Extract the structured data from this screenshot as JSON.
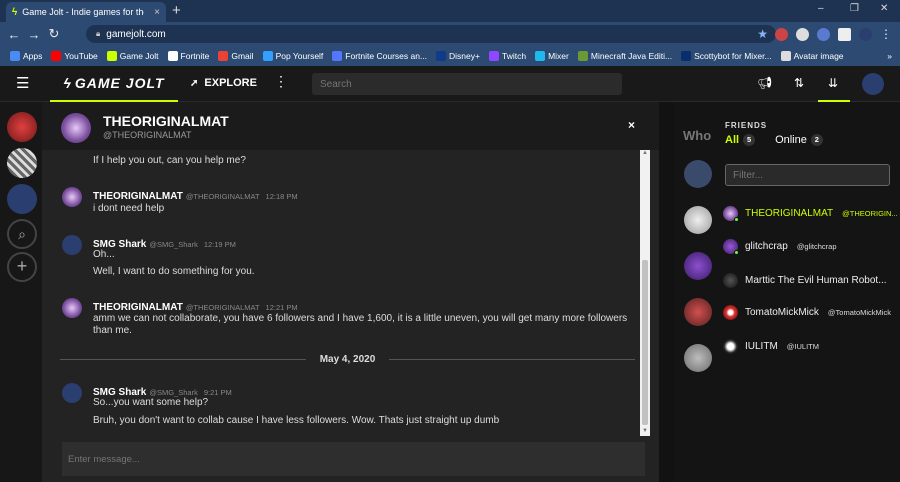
{
  "browser": {
    "tab_title": "Game Jolt - Indie games for the l",
    "tab_close": "×",
    "new_tab": "+",
    "window_controls": [
      "–",
      "❐",
      "✕"
    ],
    "url": "gamejolt.com",
    "bookmarks": [
      {
        "label": "Apps",
        "color": "#4a8af4"
      },
      {
        "label": "YouTube",
        "color": "#ff0000"
      },
      {
        "label": "Game Jolt",
        "color": "#ccff00"
      },
      {
        "label": "Fortnite",
        "color": "#ffffff"
      },
      {
        "label": "Gmail",
        "color": "#ea4335"
      },
      {
        "label": "Pop Yourself",
        "color": "#33a0ff"
      },
      {
        "label": "Fortnite Courses an...",
        "color": "#5577ff"
      },
      {
        "label": "Disney+",
        "color": "#123a8a"
      },
      {
        "label": "Twitch",
        "color": "#9146ff"
      },
      {
        "label": "Mixer",
        "color": "#1fbaed"
      },
      {
        "label": "Minecraft Java Editi...",
        "color": "#6b9a34"
      },
      {
        "label": "Scottybot for Mixer...",
        "color": "#0a2d6b"
      },
      {
        "label": "Avatar image",
        "color": "#dddddd"
      }
    ],
    "bookmarks_more": "»"
  },
  "gj_nav": {
    "logo": "GAME JOLT",
    "explore": "EXPLORE",
    "search_placeholder": "Search"
  },
  "chat": {
    "name": "THEORIGINALMAT",
    "handle": "@THEORIGINALMAT",
    "close": "×",
    "first_line": "If I help you out, can you help me?",
    "messages": [
      {
        "name": "THEORIGINALMAT",
        "handle": "@THEORIGINALMAT",
        "time": "12:18 PM",
        "lines": [
          "i dont need help"
        ]
      },
      {
        "name": "SMG Shark",
        "handle": "@SMG_Shark",
        "time": "12:19 PM",
        "lines": [
          "Oh...",
          "Well, I want to do something for you."
        ]
      },
      {
        "name": "THEORIGINALMAT",
        "handle": "@THEORIGINALMAT",
        "time": "12:21 PM",
        "lines": [
          "amm we can not collaborate, you have 6 followers and I have 1,600, it is a little uneven, you will get many more followers than me."
        ]
      },
      {
        "name": "SMG Shark",
        "handle": "@SMG_Shark",
        "time": "9:21 PM",
        "lines": [
          "So...you want some help?",
          "Bruh, you don't want to collab cause I have less followers. Wow. Thats just straight up dumb"
        ]
      }
    ],
    "date_divider": "May 4, 2020",
    "input_placeholder": "Enter message..."
  },
  "friends": {
    "who_text": "Who",
    "heading": "FRIENDS",
    "tab_all": "All",
    "tab_all_count": "5",
    "tab_online": "Online",
    "tab_online_count": "2",
    "filter_placeholder": "Filter...",
    "list": [
      {
        "name": "THEORIGINALMAT",
        "handle": "@THEORIGIN...",
        "online": true,
        "highlight": true
      },
      {
        "name": "glitchcrap",
        "handle": "@glitchcrap",
        "online": true,
        "highlight": false
      },
      {
        "name": "Marttic The Evil Human Robot...",
        "handle": "",
        "online": false,
        "highlight": false
      },
      {
        "name": "TomatoMickMick",
        "handle": "@TomatoMickMick",
        "online": false,
        "highlight": false
      },
      {
        "name": "IULITM",
        "handle": "@IULITM",
        "online": false,
        "highlight": false
      }
    ]
  },
  "colors": {
    "accent": "#ccff00",
    "online": "#66ff33"
  }
}
